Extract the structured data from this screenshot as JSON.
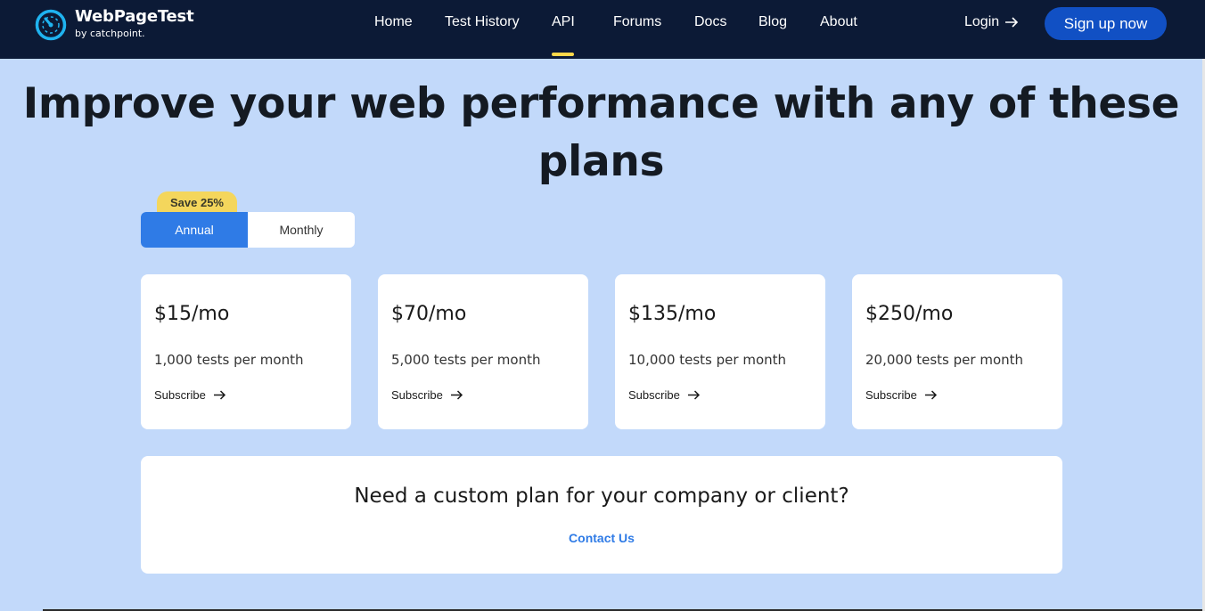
{
  "header": {
    "logo_title": "WebPageTest",
    "logo_sub": "by catchpoint.",
    "nav": [
      {
        "label": "Home"
      },
      {
        "label": "Test History"
      },
      {
        "label": "API",
        "active": true
      },
      {
        "label": "Forums"
      },
      {
        "label": "Docs"
      },
      {
        "label": "Blog"
      },
      {
        "label": "About"
      }
    ],
    "login_label": "Login",
    "signup_label": "Sign up now"
  },
  "headline": "Improve your web performance with any of these plans",
  "billing": {
    "badge": "Save 25%",
    "annual_label": "Annual",
    "monthly_label": "Monthly",
    "selected": "Annual"
  },
  "plans": [
    {
      "price": "$15/mo",
      "tests": "1,000 tests per month",
      "cta": "Subscribe"
    },
    {
      "price": "$70/mo",
      "tests": "5,000 tests per month",
      "cta": "Subscribe"
    },
    {
      "price": "$135/mo",
      "tests": "10,000 tests per month",
      "cta": "Subscribe"
    },
    {
      "price": "$250/mo",
      "tests": "20,000 tests per month",
      "cta": "Subscribe"
    }
  ],
  "custom": {
    "title": "Need a custom plan for your company or client?",
    "link": "Contact Us"
  },
  "colors": {
    "header_bg": "#0c1a36",
    "page_bg": "#c2d9fa",
    "accent_blue": "#2f7be6",
    "signup_blue": "#1150c4",
    "badge_yellow": "#f4d65c",
    "nav_active": "#ffd84a"
  }
}
